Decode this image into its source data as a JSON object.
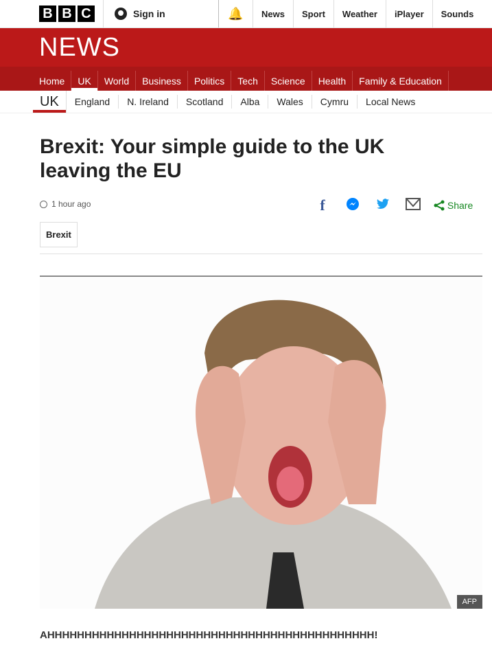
{
  "topbar": {
    "logo": [
      "B",
      "B",
      "C"
    ],
    "sign_in": "Sign in",
    "links": [
      "News",
      "Sport",
      "Weather",
      "iPlayer",
      "Sounds"
    ]
  },
  "masthead": {
    "title": "NEWS"
  },
  "nav": [
    "Home",
    "UK",
    "World",
    "Business",
    "Politics",
    "Tech",
    "Science",
    "Health",
    "Family & Education"
  ],
  "subnav": {
    "current": "UK",
    "items": [
      "England",
      "N. Ireland",
      "Scotland",
      "Alba",
      "Wales",
      "Cymru",
      "Local News"
    ]
  },
  "article": {
    "title": "Brexit: Your simple guide to the UK leaving the EU",
    "timestamp": "1 hour ago",
    "share_label": "Share",
    "tag": "Brexit",
    "image_credit": "AFP",
    "body": "AHHHHHHHHHHHHHHHHHHHHHHHHHHHHHHHHHHHHHHHHHHHH!"
  },
  "colors": {
    "brand_red": "#bb1919",
    "share_green": "#168721",
    "facebook": "#3b5998",
    "messenger": "#0084ff",
    "twitter": "#1da1f2"
  }
}
